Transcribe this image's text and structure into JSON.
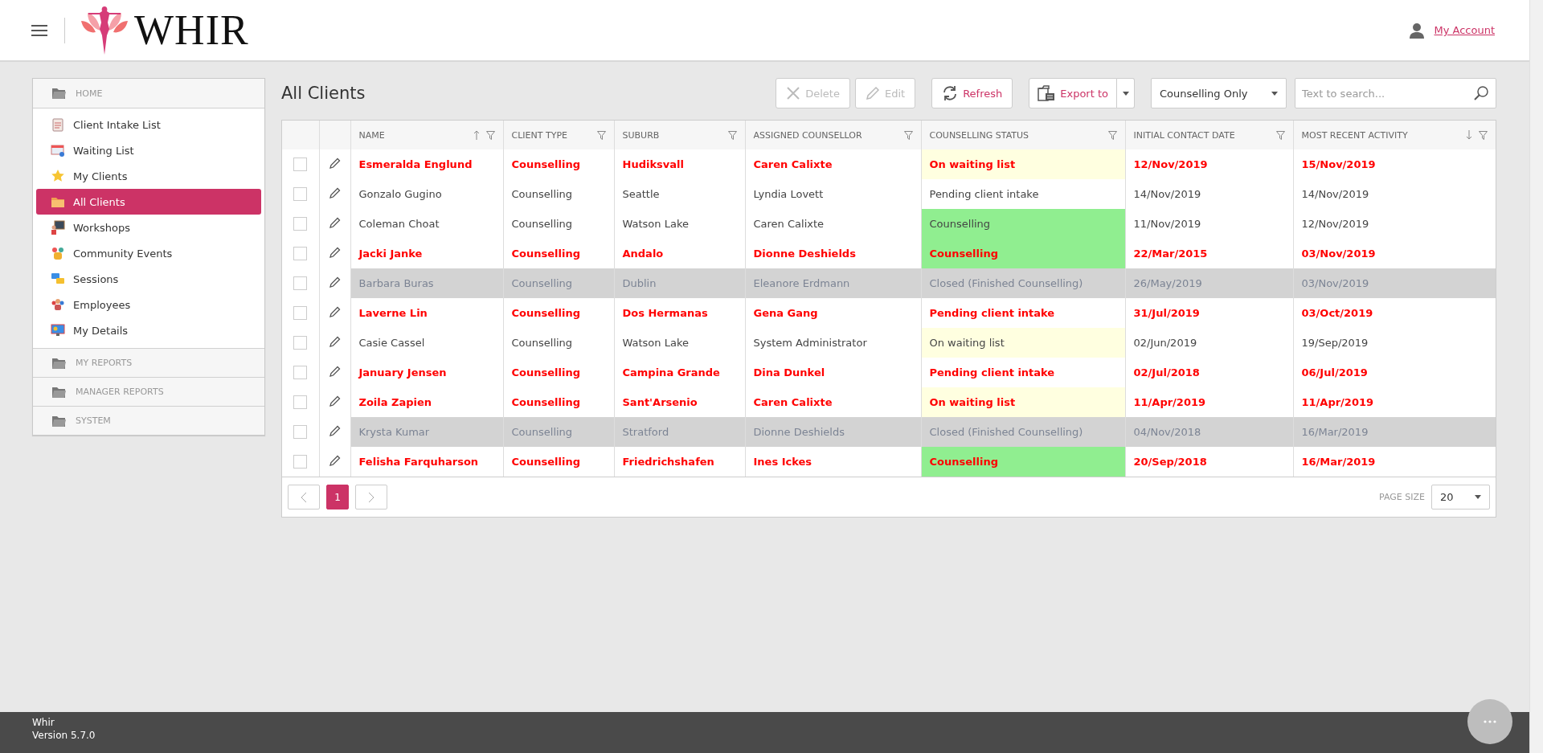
{
  "header": {
    "brand": "WHIR",
    "account_link": "My Account"
  },
  "sidebar": {
    "sections": [
      {
        "title": "HOME",
        "items": [
          {
            "label": "Client Intake List",
            "kind": "clipboard",
            "selected": false
          },
          {
            "label": "Waiting List",
            "kind": "calendar",
            "selected": false
          },
          {
            "label": "My Clients",
            "kind": "star",
            "selected": false
          },
          {
            "label": "All Clients",
            "kind": "folder",
            "selected": true
          },
          {
            "label": "Workshops",
            "kind": "board",
            "selected": false
          },
          {
            "label": "Community Events",
            "kind": "people",
            "selected": false
          },
          {
            "label": "Sessions",
            "kind": "chat",
            "selected": false
          },
          {
            "label": "Employees",
            "kind": "team",
            "selected": false
          },
          {
            "label": "My Details",
            "kind": "monitor",
            "selected": false
          }
        ]
      },
      {
        "title": "MY REPORTS"
      },
      {
        "title": "MANAGER REPORTS"
      },
      {
        "title": "SYSTEM"
      }
    ]
  },
  "page_title": "All Clients",
  "toolbar": {
    "buttons": [
      {
        "label": "Delete",
        "kind": "delete",
        "disabled": true
      },
      {
        "label": "Edit",
        "kind": "edit",
        "disabled": true
      },
      {
        "label": "Refresh",
        "kind": "refresh",
        "disabled": false
      },
      {
        "label": "Export to",
        "kind": "export",
        "disabled": false
      }
    ],
    "filter": "Counselling Only",
    "search": {
      "placeholder": "Text to search..."
    }
  },
  "table": {
    "columns": [
      {
        "label": "NAME",
        "kind": "ascending"
      },
      {
        "label": "CLIENT TYPE",
        "kind": "plain"
      },
      {
        "label": "SUBURB",
        "kind": "plain"
      },
      {
        "label": "ASSIGNED COUNSELLOR",
        "kind": "plain"
      },
      {
        "label": "COUNSELLING STATUS",
        "kind": "plain"
      },
      {
        "label": "INITIAL CONTACT DATE",
        "kind": "plain"
      },
      {
        "label": "MOST RECENT ACTIVITY",
        "kind": "descending"
      }
    ],
    "rows": [
      {
        "kind": "flagged",
        "checked": false,
        "cells": [
          "Esmeralda Englund",
          "Counselling",
          "Hudiksvall",
          "Caren Calixte"
        ],
        "status": {
          "label": "On waiting list",
          "color": "#ffffe0"
        },
        "dates": [
          "12/Nov/2019",
          "15/Nov/2019"
        ]
      },
      {
        "kind": "normal",
        "checked": false,
        "cells": [
          "Gonzalo Gugino",
          "Counselling",
          "Seattle",
          "Lyndia Lovett"
        ],
        "status": {
          "label": "Pending client intake"
        },
        "dates": [
          "14/Nov/2019",
          "14/Nov/2019"
        ]
      },
      {
        "kind": "normal",
        "checked": false,
        "cells": [
          "Coleman Choat",
          "Counselling",
          "Watson Lake",
          "Caren Calixte"
        ],
        "status": {
          "label": "Counselling",
          "color": "#90ee90"
        },
        "dates": [
          "11/Nov/2019",
          "12/Nov/2019"
        ]
      },
      {
        "kind": "flagged",
        "checked": false,
        "cells": [
          "Jacki Janke",
          "Counselling",
          "Andalo",
          "Dionne Deshields"
        ],
        "status": {
          "label": "Counselling",
          "color": "#90ee90"
        },
        "dates": [
          "22/Mar/2015",
          "03/Nov/2019"
        ]
      },
      {
        "kind": "closed",
        "checked": false,
        "cells": [
          "Barbara Buras",
          "Counselling",
          "Dublin",
          "Eleanore Erdmann"
        ],
        "status": {
          "label": "Closed (Finished Counselling)"
        },
        "dates": [
          "26/May/2019",
          "03/Nov/2019"
        ]
      },
      {
        "kind": "flagged",
        "checked": false,
        "cells": [
          "Laverne Lin",
          "Counselling",
          "Dos Hermanas",
          "Gena Gang"
        ],
        "status": {
          "label": "Pending client intake"
        },
        "dates": [
          "31/Jul/2019",
          "03/Oct/2019"
        ]
      },
      {
        "kind": "normal",
        "checked": false,
        "cells": [
          "Casie Cassel",
          "Counselling",
          "Watson Lake",
          "System Administrator"
        ],
        "status": {
          "label": "On waiting list",
          "color": "#ffffe0"
        },
        "dates": [
          "02/Jun/2019",
          "19/Sep/2019"
        ]
      },
      {
        "kind": "flagged",
        "checked": false,
        "cells": [
          "January Jensen",
          "Counselling",
          "Campina Grande",
          "Dina Dunkel"
        ],
        "status": {
          "label": "Pending client intake"
        },
        "dates": [
          "02/Jul/2018",
          "06/Jul/2019"
        ]
      },
      {
        "kind": "flagged",
        "checked": false,
        "cells": [
          "Zoila Zapien",
          "Counselling",
          "Sant'Arsenio",
          "Caren Calixte"
        ],
        "status": {
          "label": "On waiting list",
          "color": "#ffffe0"
        },
        "dates": [
          "11/Apr/2019",
          "11/Apr/2019"
        ]
      },
      {
        "kind": "closed",
        "checked": false,
        "cells": [
          "Krysta Kumar",
          "Counselling",
          "Stratford",
          "Dionne Deshields"
        ],
        "status": {
          "label": "Closed (Finished Counselling)"
        },
        "dates": [
          "04/Nov/2018",
          "16/Mar/2019"
        ]
      },
      {
        "kind": "flagged",
        "checked": false,
        "cells": [
          "Felisha Farquharson",
          "Counselling",
          "Friedrichshafen",
          "Ines Ickes"
        ],
        "status": {
          "label": "Counselling",
          "color": "#90ee90"
        },
        "dates": [
          "20/Sep/2018",
          "16/Mar/2019"
        ]
      }
    ]
  },
  "pager": {
    "pages": [
      {
        "label": "1",
        "selected": true
      }
    ],
    "page_size_label": "PAGE SIZE",
    "page_size": "20"
  },
  "footer": {
    "app": "Whir",
    "version": "Version 5.7.0"
  }
}
